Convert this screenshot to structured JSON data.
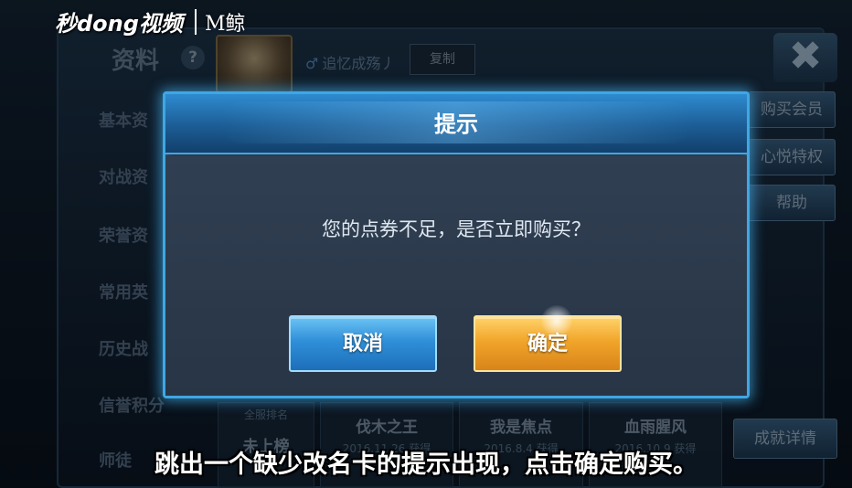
{
  "background": {
    "title": "资料",
    "help_icon_glyph": "?",
    "player_name": "追忆成殇丿",
    "gender_icon_glyph": "♂",
    "copy_label": "复制",
    "close_icon_glyph": "✖",
    "side_menu": [
      "基本资",
      "对战资",
      "荣誉资",
      "常用英",
      "历史战",
      "信誉积分",
      "师徒"
    ],
    "right_buttons": [
      "购买会员",
      "心悦特权",
      "帮助"
    ],
    "stats": [
      {
        "title": "未上榜",
        "sub": "全服排名"
      },
      {
        "title": "伐木之王",
        "sub": "2016.11.26 获得"
      },
      {
        "title": "我是焦点",
        "sub": "2016.8.4 获得"
      },
      {
        "title": "血雨腥风",
        "sub": "2016.10.9 获得"
      }
    ],
    "achievements_button": "成就详情"
  },
  "logo": {
    "text": "秒dong视频",
    "brand": "M鲸"
  },
  "dialog": {
    "title": "提示",
    "message": "您的点券不足，是否立即购买？",
    "cancel_label": "取消",
    "confirm_label": "确定"
  },
  "caption": "跳出一个缺少改名卡的提示出现，点击确定购买。",
  "colors": {
    "dialog_border": "#3fa7e3",
    "cancel_button": "#2f8fd8",
    "confirm_button": "#f1a52a"
  }
}
